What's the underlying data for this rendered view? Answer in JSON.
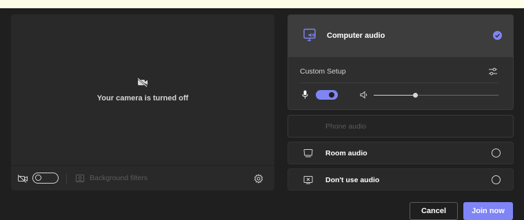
{
  "video": {
    "camera_off_text": "Your camera is turned off",
    "background_filters_label": "Background filters",
    "camera_toggle_on": false
  },
  "audio": {
    "computer": {
      "label": "Computer audio",
      "selected": true,
      "custom_setup_label": "Custom Setup",
      "mic_enabled": true,
      "volume_level": 0.33
    },
    "phone": {
      "label": "Phone audio",
      "disabled": true
    },
    "room": {
      "label": "Room audio",
      "selected": false
    },
    "none": {
      "label": "Don't use audio",
      "selected": false
    }
  },
  "actions": {
    "cancel_label": "Cancel",
    "join_label": "Join now"
  },
  "colors": {
    "accent": "#7f85f5",
    "background": "#1f1f1f",
    "panel": "#292929"
  },
  "icons": {
    "camera_off": "video-off-icon",
    "settings": "gear-icon",
    "computer_audio": "monitor-speaker-icon",
    "room_audio": "room-monitor-icon",
    "no_audio": "screen-x-icon",
    "mic": "microphone-icon",
    "speaker": "speaker-icon",
    "check": "checkmark-circle-icon",
    "custom_setup": "sliders-icon",
    "background_filters": "background-effects-icon"
  }
}
